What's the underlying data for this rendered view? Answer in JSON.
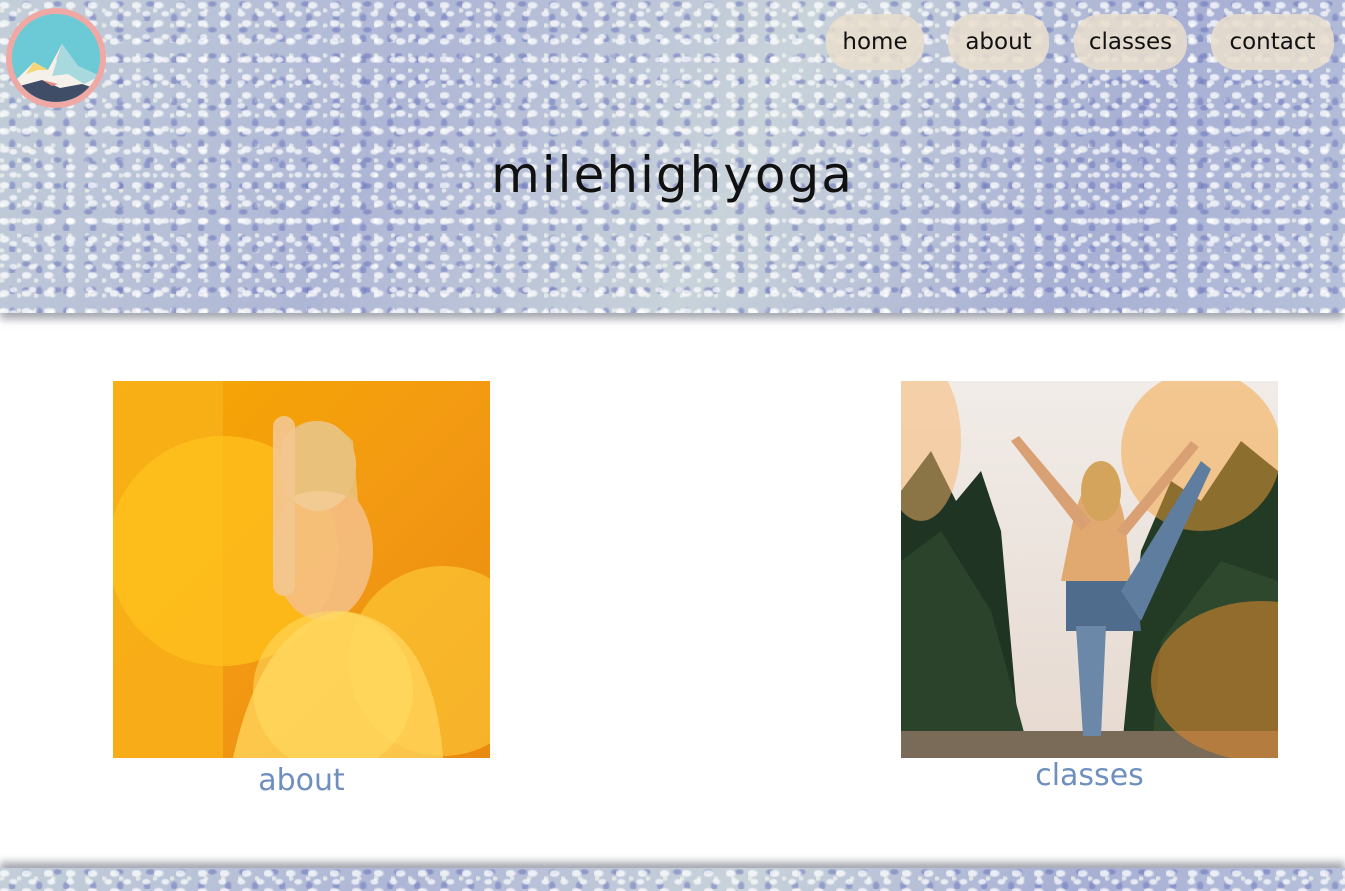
{
  "header": {
    "site_title": "milehighyoga",
    "logo_icon": "mountain-logo-icon"
  },
  "nav": {
    "items": [
      {
        "label": "home"
      },
      {
        "label": "about"
      },
      {
        "label": "classes"
      },
      {
        "label": "contact"
      }
    ]
  },
  "cards": [
    {
      "label": "about",
      "image_icon": "woman-praying-hands-photo"
    },
    {
      "label": "classes",
      "image_icon": "woman-dancer-pose-photo"
    }
  ],
  "colors": {
    "link_blue": "#6f8fbf",
    "nav_pill": "#e8decd",
    "logo_ring": "#f0a8a4",
    "logo_sky": "#6ccad6"
  }
}
